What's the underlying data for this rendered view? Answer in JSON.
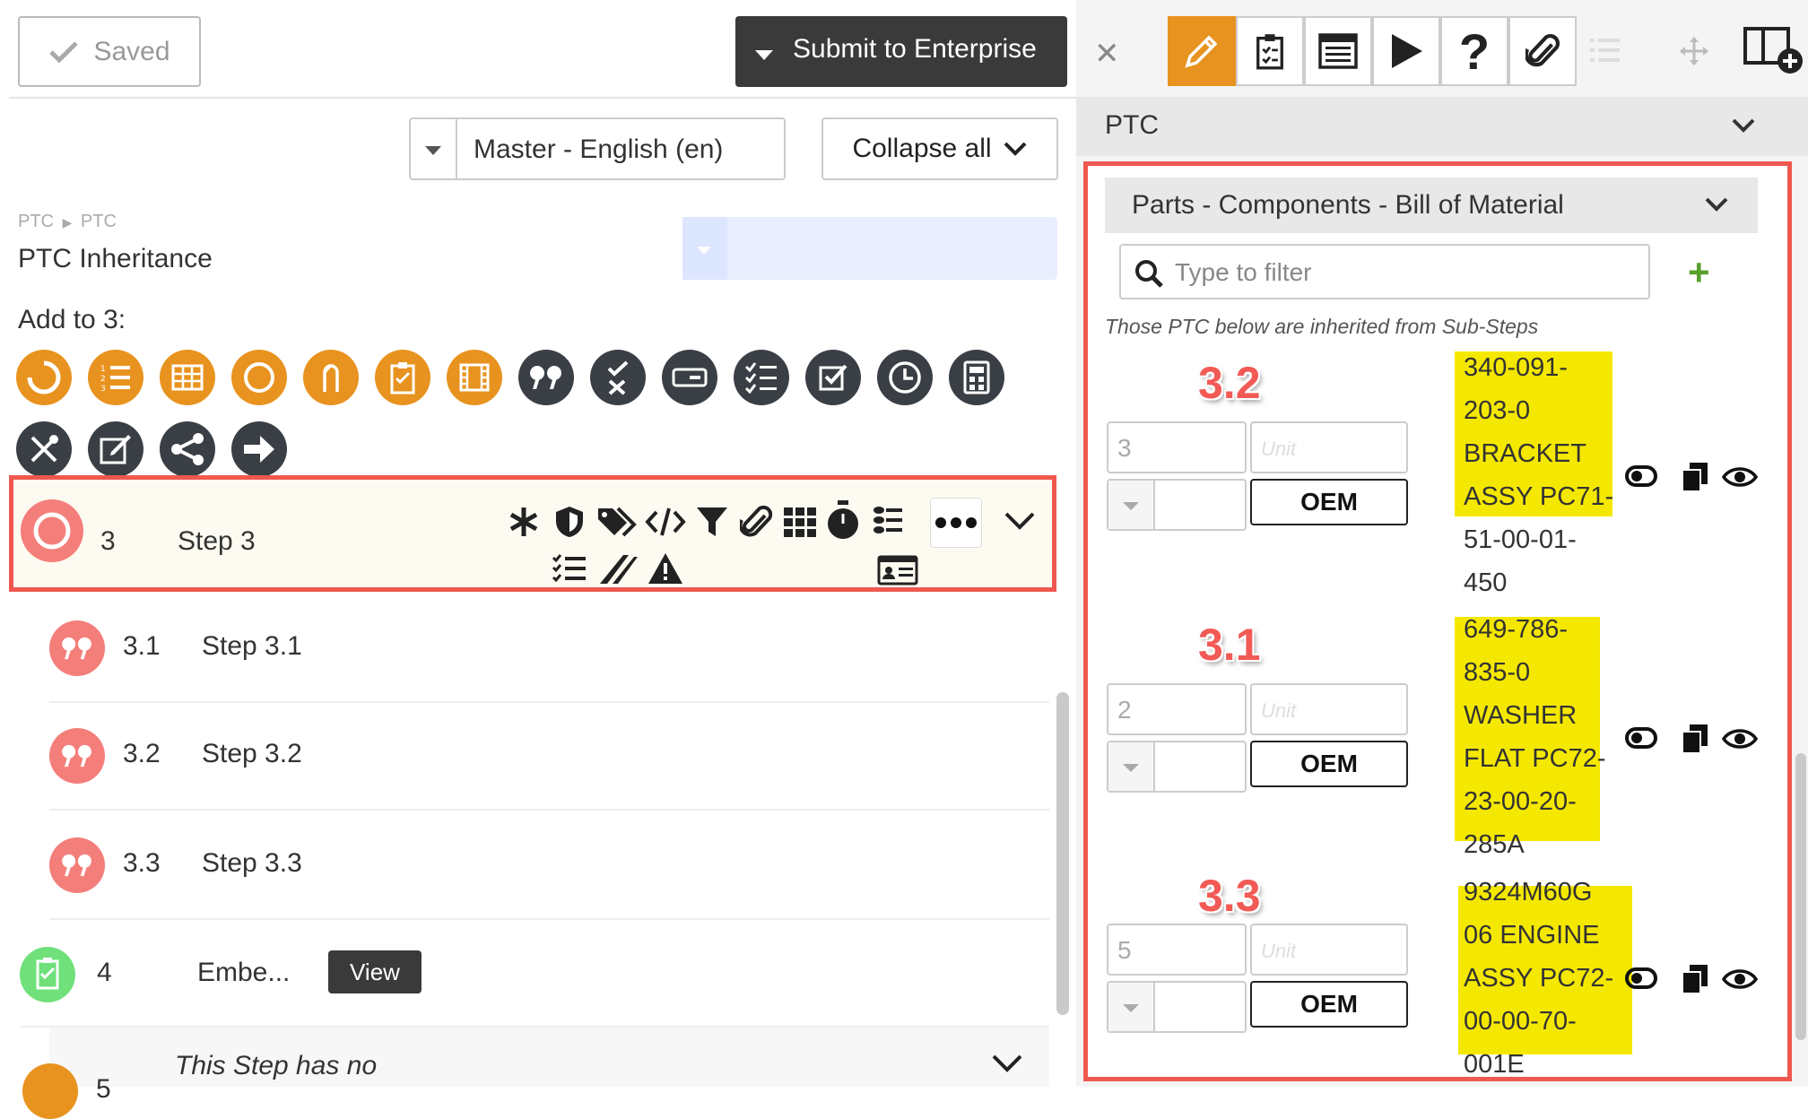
{
  "toolbar": {
    "saved_label": "Saved",
    "submit_label": "Submit to Enterprise"
  },
  "editor": {
    "language": "Master - English (en)",
    "collapse_label": "Collapse all",
    "breadcrumb": [
      "PTC",
      "PTC"
    ],
    "inheritance_title": "PTC Inheritance",
    "add_to_label": "Add to 3:"
  },
  "steps": [
    {
      "num": "3",
      "name": "Step 3"
    },
    {
      "num": "3.1",
      "name": "Step 3.1"
    },
    {
      "num": "3.2",
      "name": "Step 3.2"
    },
    {
      "num": "3.3",
      "name": "Step 3.3"
    },
    {
      "num": "4",
      "name": "Embe...",
      "view_label": "View"
    },
    {
      "num": "5",
      "name": "This Step has no"
    }
  ],
  "panel": {
    "section_title": "PTC",
    "parts_title": "Parts - Components - Bill of Material",
    "filter_placeholder": "Type to filter",
    "inherited_note": "Those PTC below are inherited from Sub-Steps",
    "parts": [
      {
        "tag": "3.2",
        "qty": "3",
        "unit_placeholder": "Unit",
        "oem": "OEM",
        "lines": [
          "340-091-",
          "203-0",
          "BRACKET",
          "ASSY PC71-",
          "51-00-01-",
          "450"
        ],
        "highlight_lines": 4
      },
      {
        "tag": "3.1",
        "qty": "2",
        "unit_placeholder": "Unit",
        "oem": "OEM",
        "lines": [
          "649-786-",
          "835-0",
          "WASHER",
          "FLAT PC72-",
          "23-00-20-",
          "285A"
        ],
        "highlight_lines": 5
      },
      {
        "tag": "3.3",
        "qty": "5",
        "unit_placeholder": "Unit",
        "oem": "OEM",
        "lines": [
          "9324M60G",
          "06 ENGINE",
          "ASSY PC72-",
          "00-00-70-",
          "001E"
        ],
        "highlight_lines": 4
      }
    ]
  },
  "colors": {
    "accent_orange": "#e8931f",
    "dark_icon": "#3a3f45",
    "highlight_red": "#f0584f",
    "marker_yellow": "#f5e800"
  }
}
